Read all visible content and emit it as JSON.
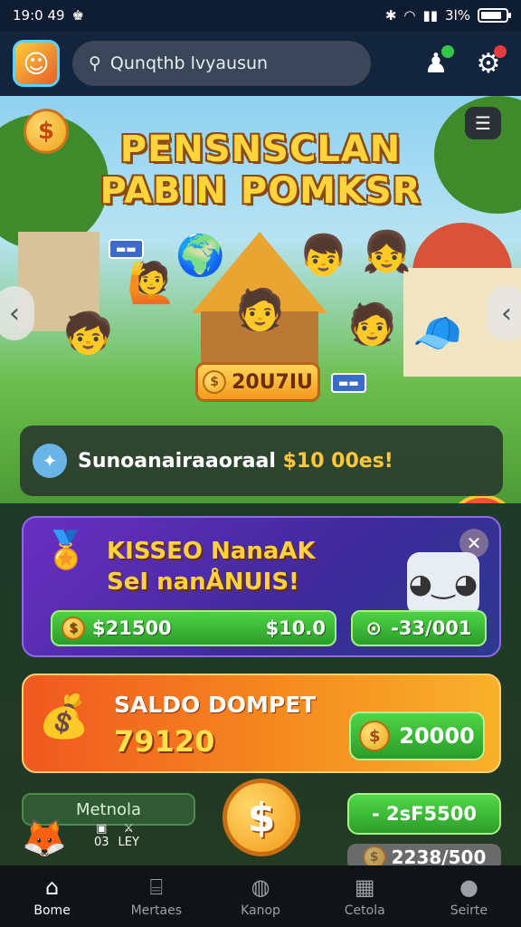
{
  "status_bar": {
    "time": "19:0 49",
    "battery_text": "3l%"
  },
  "header": {
    "search_text": "Qunqthb lvyausun"
  },
  "hero": {
    "title_line1": "PENSNSCLAN",
    "title_line2": "PABIN POMKSR",
    "pill_value": "20U7IU"
  },
  "promo": {
    "text_prefix": "Sunoanairaaoraal ",
    "text_highlight": "$10 00es!"
  },
  "mission": {
    "title_line1": "KISSEO NanaAK",
    "title_line2": "SeI nanÅNUIS!",
    "reward_left": "$21500",
    "reward_middle": "$10.0",
    "reward_right": "-33/001"
  },
  "wallet": {
    "label": "SALDO DOMPET",
    "balance": "79120",
    "button_value": "20000"
  },
  "bottom": {
    "mini_pill": "Metnola",
    "mini_icon_1_label": "03",
    "mini_icon_2_label": "LEY",
    "green_value": "- 2sF5500",
    "grey_value": "2238/500"
  },
  "tabs": [
    {
      "label": "Bome",
      "icon": "home-icon"
    },
    {
      "label": "Mertaes",
      "icon": "store-icon"
    },
    {
      "label": "Kanop",
      "icon": "bag-icon"
    },
    {
      "label": "Cetola",
      "icon": "calendar-icon"
    },
    {
      "label": "Seirte",
      "icon": "profile-icon"
    }
  ]
}
